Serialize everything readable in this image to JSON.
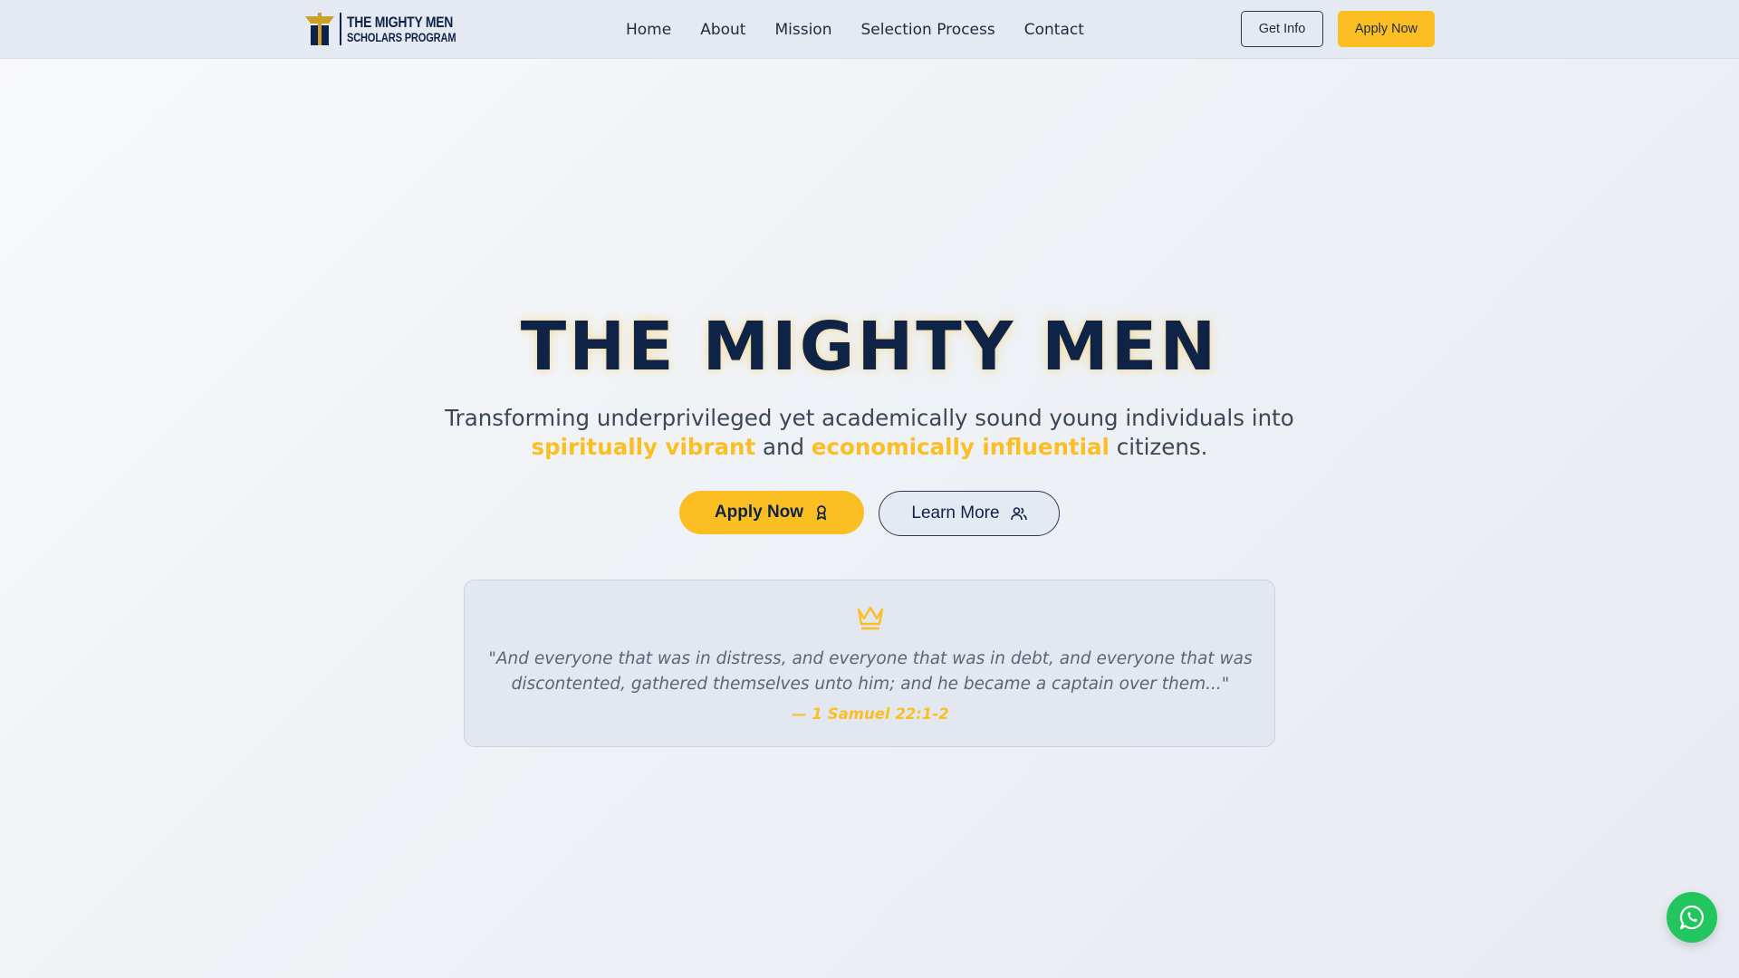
{
  "nav": {
    "logo": {
      "line1": "THE MIGHTY MEN",
      "line2": "SCHOLARS PROGRAM"
    },
    "links": [
      {
        "label": "Home"
      },
      {
        "label": "About"
      },
      {
        "label": "Mission"
      },
      {
        "label": "Selection Process"
      },
      {
        "label": "Contact"
      }
    ],
    "get_info_label": "Get Info",
    "apply_label": "Apply Now"
  },
  "hero": {
    "title": "THE MIGHTY MEN",
    "subtitle": {
      "part1": "Transforming underprivileged yet academically sound young individuals into ",
      "highlight1": "spiritually vibrant",
      "part2": " and ",
      "highlight2": "economically influential",
      "part3": " citizens."
    },
    "apply_label": "Apply Now",
    "apply_icon": "award-icon",
    "learn_label": "Learn More",
    "learn_icon": "users-icon"
  },
  "quote": {
    "icon": "crown-icon",
    "text": "\"And everyone that was in distress, and everyone that was in debt, and everyone that was discontented, gathered themselves unto him; and he became a captain over them...\"",
    "reference": "— 1 Samuel 22:1-2"
  },
  "floating": {
    "icon": "whatsapp-icon"
  },
  "colors": {
    "accent": "#fbbf24",
    "navy": "#0f2347",
    "whatsapp": "#22c55e"
  }
}
